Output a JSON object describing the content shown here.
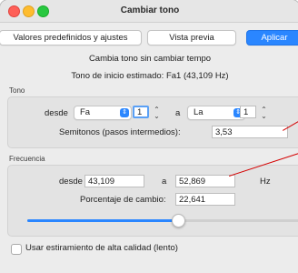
{
  "window": {
    "title": "Cambiar tono"
  },
  "toolbar": {
    "presets_label": "Valores predefinidos y ajustes",
    "preview_label": "Vista previa",
    "apply_label": "Aplicar"
  },
  "info": {
    "subtitle": "Cambia tono sin cambiar tempo",
    "start_tone": "Tono de inicio estimado: Fa1 (43,109 Hz)"
  },
  "tone": {
    "group_label": "Tono",
    "from_label": "desde",
    "from_note": "Fa",
    "from_octave": "1",
    "to_label": "a",
    "to_note": "La",
    "to_octave": "1",
    "semitones_label": "Semitonos (pasos intermedios):",
    "semitones_value": "3,53"
  },
  "frequency": {
    "group_label": "Frecuencia",
    "from_label": "desde",
    "from_value": "43,109",
    "to_label": "a",
    "to_value": "52,869",
    "unit": "Hz",
    "percent_label": "Porcentaje de cambio:",
    "percent_value": "22,641",
    "slider_level": 0.55
  },
  "options": {
    "high_quality_label": "Usar estiramiento de alta calidad (lento)",
    "high_quality_checked": false
  },
  "colors": {
    "accent": "#2a86ff",
    "annotation": "#d40000"
  }
}
